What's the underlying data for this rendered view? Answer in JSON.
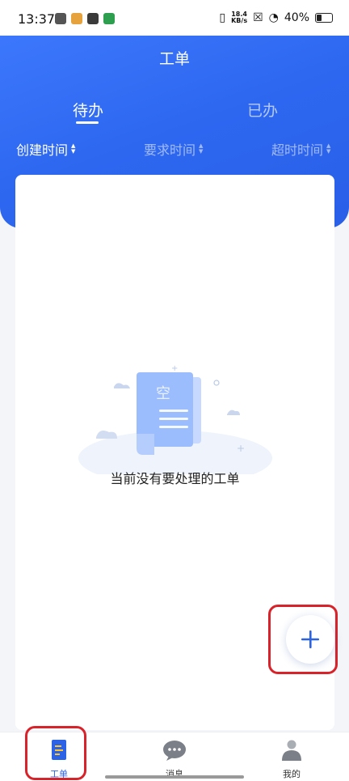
{
  "status_bar": {
    "time": "13:37",
    "speed_top": "18.4",
    "speed_bottom": "KB/s",
    "battery": "40%"
  },
  "header": {
    "title": "工单"
  },
  "tabs": [
    {
      "label": "待办",
      "active": true
    },
    {
      "label": "已办",
      "active": false
    }
  ],
  "sort_options": [
    {
      "label": "创建时间",
      "active": true
    },
    {
      "label": "要求时间",
      "active": false
    },
    {
      "label": "超时时间",
      "active": false
    }
  ],
  "empty_state": {
    "badge": "空",
    "message": "当前没有要处理的工单"
  },
  "bottom_nav": [
    {
      "label": "工单",
      "icon": "document-icon",
      "active": true
    },
    {
      "label": "消息",
      "icon": "chat-bubble-icon",
      "active": false
    },
    {
      "label": "我的",
      "icon": "user-icon",
      "active": false
    }
  ],
  "colors": {
    "primary": "#2b62e6",
    "header_gradient_start": "#3f7bff",
    "highlight": "#d8232a"
  }
}
